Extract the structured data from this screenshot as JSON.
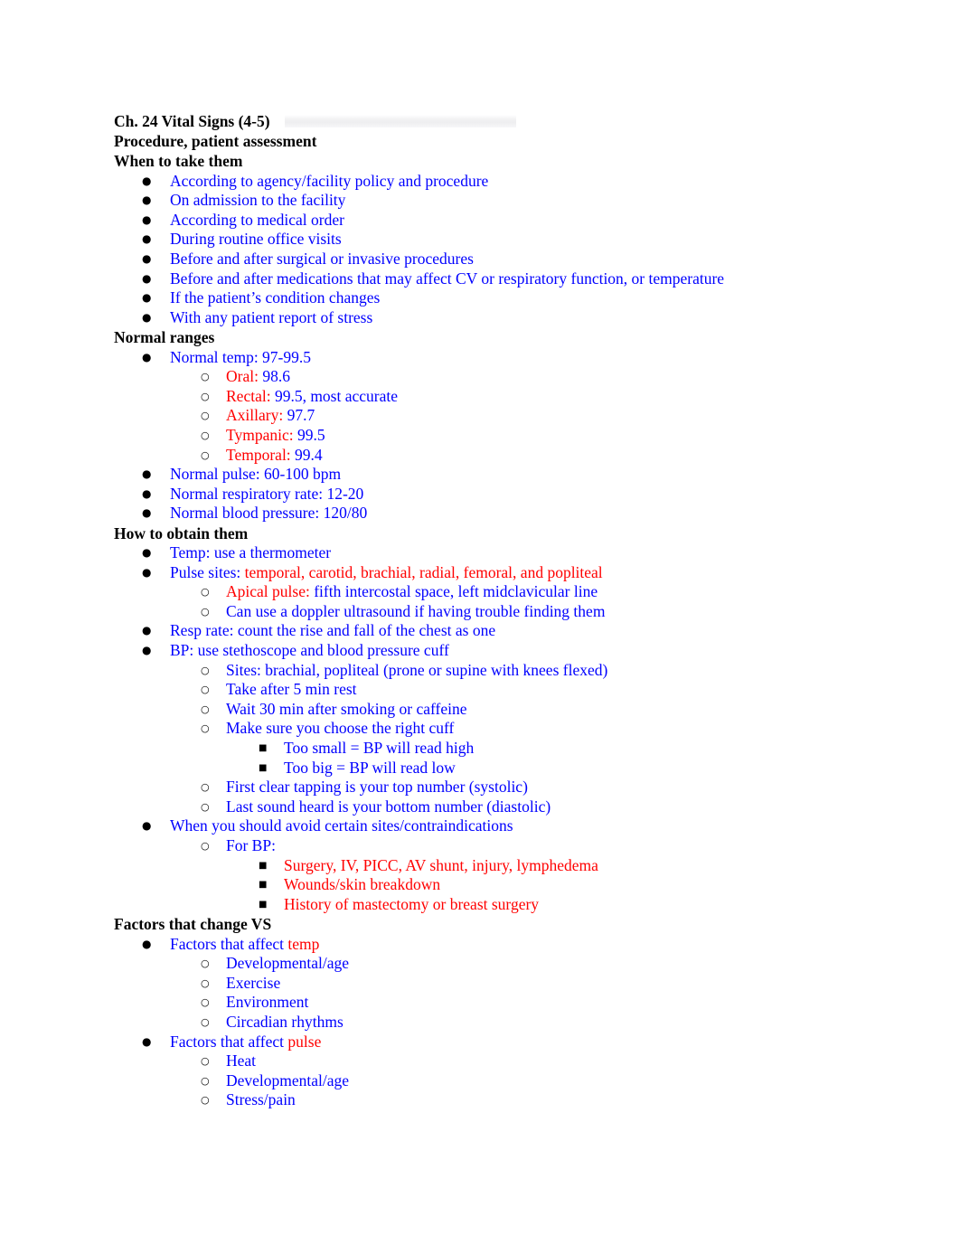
{
  "document": {
    "title": "Ch. 24 Vital Signs (4-5)",
    "colors": {
      "blue": "#0000ff",
      "red": "#ff0000",
      "black": "#000000",
      "page_background": "#ffffff",
      "title_highlight": "#eeeef0"
    },
    "bullets": {
      "level1": "●",
      "level2": "○",
      "level3": "■"
    }
  },
  "headings": {
    "doc_title": "Ch. 24 Vital Signs (4-5)",
    "procedure": "Procedure, patient assessment",
    "when_to_take": "When to take them",
    "normal_ranges": "Normal ranges",
    "how_to_obtain": "How to obtain them",
    "factors_change": "Factors that change VS"
  },
  "when_to_take_items": [
    "According to agency/facility policy and procedure",
    "On admission to the facility",
    "According to medical order",
    "During routine office visits",
    "Before and after surgical or invasive procedures",
    "Before and after medications that may affect CV or respiratory function, or temperature",
    "If the patient’s condition changes",
    "With any patient report of stress"
  ],
  "normal_ranges": {
    "temp_line": "Normal temp: 97-99.5",
    "routes": [
      {
        "label": "Oral:",
        "value": " 98.6"
      },
      {
        "label": "Rectal:",
        "value": " 99.5, most accurate"
      },
      {
        "label": "Axillary:",
        "value": " 97.7"
      },
      {
        "label": "Tympanic:",
        "value": " 99.5"
      },
      {
        "label": "Temporal:",
        "value": " 99.4"
      }
    ],
    "pulse": "Normal pulse: 60-100 bpm",
    "resp": "Normal respiratory rate: 12-20",
    "bp": "Normal blood pressure: 120/80"
  },
  "how_to_obtain": {
    "temp": "Temp: use a thermometer",
    "pulse_sites_label": "Pulse sites:",
    "pulse_sites_value": " temporal, carotid, brachial, radial, femoral, and popliteal",
    "apical_label": "Apical pulse:",
    "apical_value": " fifth intercostal space, left midclavicular line",
    "doppler": "Can use a doppler ultrasound if having trouble finding them",
    "resp_rate": "Resp rate: count the rise and fall of the chest as one",
    "bp_method": "BP: use stethoscope and blood pressure cuff",
    "bp_sub": [
      "Sites: brachial, popliteal (prone or supine with knees flexed)",
      "Take after 5 min rest",
      "Wait 30 min after smoking or caffeine",
      "Make sure you choose the right cuff"
    ],
    "cuff_sizes": [
      "Too small = BP will read high",
      "Too big = BP will read low"
    ],
    "bp_sub2": [
      "First clear tapping is your top number (systolic)",
      "Last sound heard is your bottom number (diastolic)"
    ],
    "avoid_header": "When you should avoid certain sites/contraindications",
    "avoid_for_bp": "For BP:",
    "avoid_items": [
      "Surgery, IV, PICC, AV shunt, injury, lymphedema",
      "Wounds/skin breakdown",
      "History of mastectomy or breast surgery"
    ]
  },
  "factors": {
    "temp_label": "Factors that affect ",
    "temp_word": "temp",
    "temp_items": [
      "Developmental/age",
      "Exercise",
      "Environment",
      "Circadian rhythms"
    ],
    "pulse_label": "Factors that affect ",
    "pulse_word": "pulse",
    "pulse_items": [
      "Heat",
      "Developmental/age",
      "Stress/pain"
    ]
  }
}
